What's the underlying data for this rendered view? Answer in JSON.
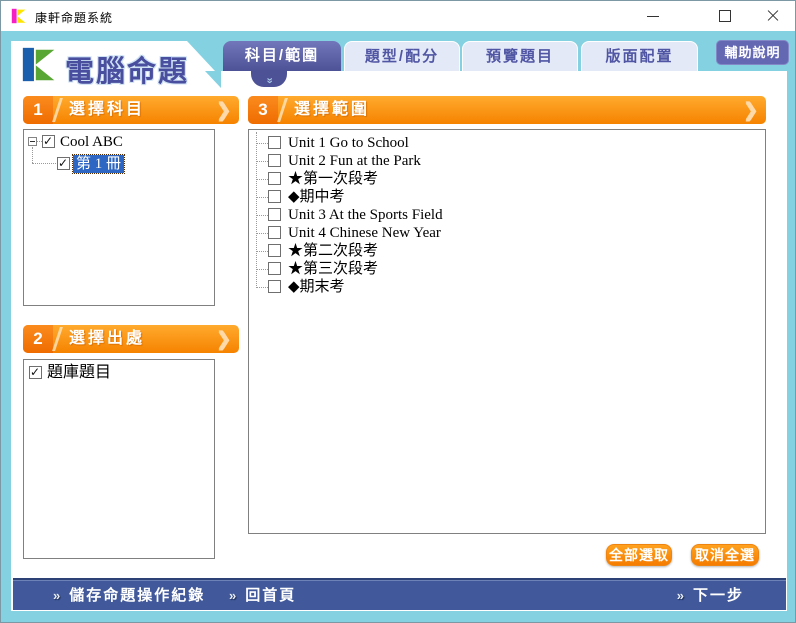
{
  "window": {
    "title": "康軒命題系統"
  },
  "header": {
    "logo_text": "電腦命題",
    "help_button": "輔助說明",
    "tabs": [
      {
        "label": "科目/範圍",
        "active": true
      },
      {
        "label": "題型/配分",
        "active": false
      },
      {
        "label": "預覽題目",
        "active": false
      },
      {
        "label": "版面配置",
        "active": false
      }
    ],
    "bump_arrow": "»"
  },
  "panels": {
    "subject": {
      "step": "1",
      "title": "選擇科目",
      "tree": [
        {
          "label": "Cool ABC",
          "checked": true,
          "selected": false
        },
        {
          "label": "第 1 冊",
          "checked": true,
          "selected": true
        }
      ]
    },
    "source": {
      "step": "2",
      "title": "選擇出處",
      "items": [
        {
          "label": "題庫題目",
          "checked": true
        }
      ]
    },
    "range": {
      "step": "3",
      "title": "選擇範圍",
      "items": [
        {
          "label": "Unit 1 Go to School",
          "checked": false
        },
        {
          "label": "Unit 2 Fun at the Park",
          "checked": false
        },
        {
          "label": "★第一次段考",
          "checked": false
        },
        {
          "label": "◆期中考",
          "checked": false
        },
        {
          "label": "Unit 3 At the Sports Field",
          "checked": false
        },
        {
          "label": "Unit 4 Chinese New Year",
          "checked": false
        },
        {
          "label": "★第二次段考",
          "checked": false
        },
        {
          "label": "★第三次段考",
          "checked": false
        },
        {
          "label": "◆期末考",
          "checked": false
        }
      ],
      "select_all_button": "全部選取",
      "deselect_all_button": "取消全選"
    },
    "banner_chevron": "❯"
  },
  "footer": {
    "arrow": "»",
    "save_link": "儲存命題操作紀錄",
    "home_link": "回首頁",
    "next_link": "下一步"
  },
  "colors": {
    "background_cyan": "#84d1e1",
    "accent_orange": "#f68300",
    "active_tab_purple": "#4d5195",
    "selection_blue": "#2e66c4",
    "footer_navy": "#41599b"
  }
}
